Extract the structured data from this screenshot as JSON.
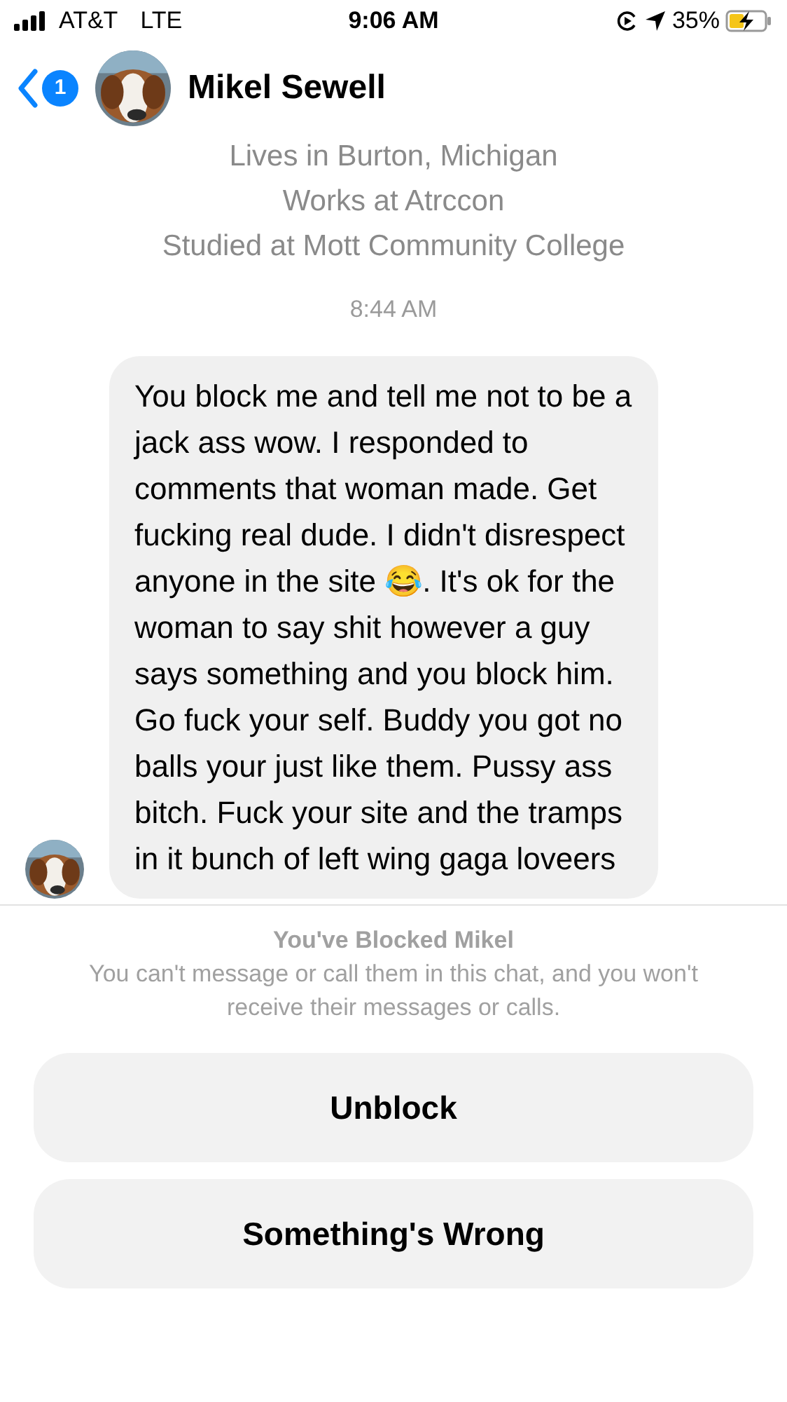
{
  "status_bar": {
    "carrier": "AT&T",
    "network": "LTE",
    "time": "9:06 AM",
    "battery": "35%"
  },
  "header": {
    "badge": "1",
    "name": "Mikel Sewell"
  },
  "profile_info": [
    "Lives in Burton, Michigan",
    "Works at Atrccon",
    "Studied at Mott Community College"
  ],
  "timestamp": "8:44 AM",
  "message": {
    "text": "You block me and tell me not to be a jack ass wow. I responded to comments that woman made. Get fucking real dude. I didn't disrespect anyone in the site 😂. It's ok for the woman to say shit however a guy says something and you block him. Go fuck your self. Buddy you got no balls your just like them. Pussy ass bitch. Fuck your site and the tramps in it bunch of left wing gaga loveers"
  },
  "blocked_notice": {
    "title": "You've Blocked Mikel",
    "description": "You can't message or call them in this chat, and you won't receive their messages or calls."
  },
  "buttons": [
    "Unblock",
    "Something's Wrong"
  ]
}
